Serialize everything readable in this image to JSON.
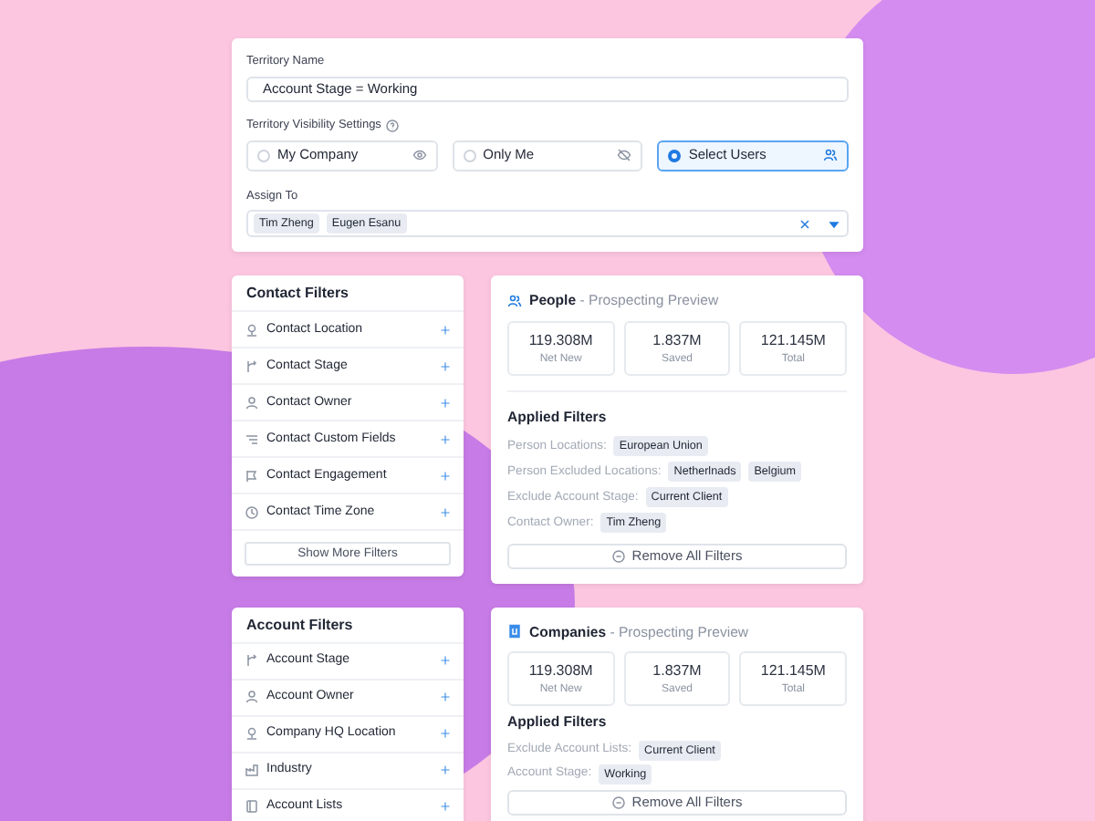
{
  "territory_name": {
    "label": "Territory Name",
    "value": "Account Stage = Working"
  },
  "visibility": {
    "label": "Territory Visibility Settings",
    "options": [
      {
        "label": "My Company",
        "selected": false
      },
      {
        "label": "Only Me",
        "selected": false
      },
      {
        "label": "Select Users",
        "selected": true
      }
    ]
  },
  "assign_to": {
    "label": "Assign To",
    "tags": [
      "Tim Zheng",
      "Eugen Esanu"
    ]
  },
  "sections": [
    {
      "filters": {
        "title": "Contact Filters",
        "items": [
          "Contact Location",
          "Contact Stage",
          "Contact Owner",
          "Contact Custom Fields",
          "Contact Engagement",
          "Contact Time Zone"
        ],
        "more_button": "Show More Filters"
      },
      "preview": {
        "title": "People",
        "subtitle": "- Prospecting Preview",
        "stats": [
          {
            "value": "119.308M",
            "label": "Net New"
          },
          {
            "value": "1.837M",
            "label": "Saved"
          },
          {
            "value": "121.145M",
            "label": "Total"
          }
        ],
        "applied_title": "Applied Filters",
        "applied": [
          {
            "label": "Person Locations:",
            "tags": [
              "European Union"
            ]
          },
          {
            "label": "Person Excluded Locations:",
            "tags": [
              "Netherlnads",
              "Belgium"
            ]
          },
          {
            "label": "Exclude Account Stage:",
            "tags": [
              "Current Client"
            ]
          },
          {
            "label": "Contact Owner:",
            "tags": [
              "Tim Zheng"
            ]
          }
        ],
        "remove_button": "Remove All Filters"
      }
    },
    {
      "filters": {
        "title": "Account Filters",
        "items": [
          "Account Stage",
          "Account Owner",
          "Company HQ Location",
          "Industry",
          "Account Lists"
        ]
      },
      "preview": {
        "title": "Companies",
        "subtitle": "- Prospecting Preview",
        "stats": [
          {
            "value": "119.308M",
            "label": "Net New"
          },
          {
            "value": "1.837M",
            "label": "Saved"
          },
          {
            "value": "121.145M",
            "label": "Total"
          }
        ],
        "applied_title": "Applied Filters",
        "applied": [
          {
            "label": "Exclude Account Lists:",
            "tags": [
              "Current Client"
            ]
          },
          {
            "label": "Account Stage:",
            "tags": [
              "Working"
            ]
          }
        ],
        "remove_button": "Remove All Filters"
      }
    }
  ]
}
